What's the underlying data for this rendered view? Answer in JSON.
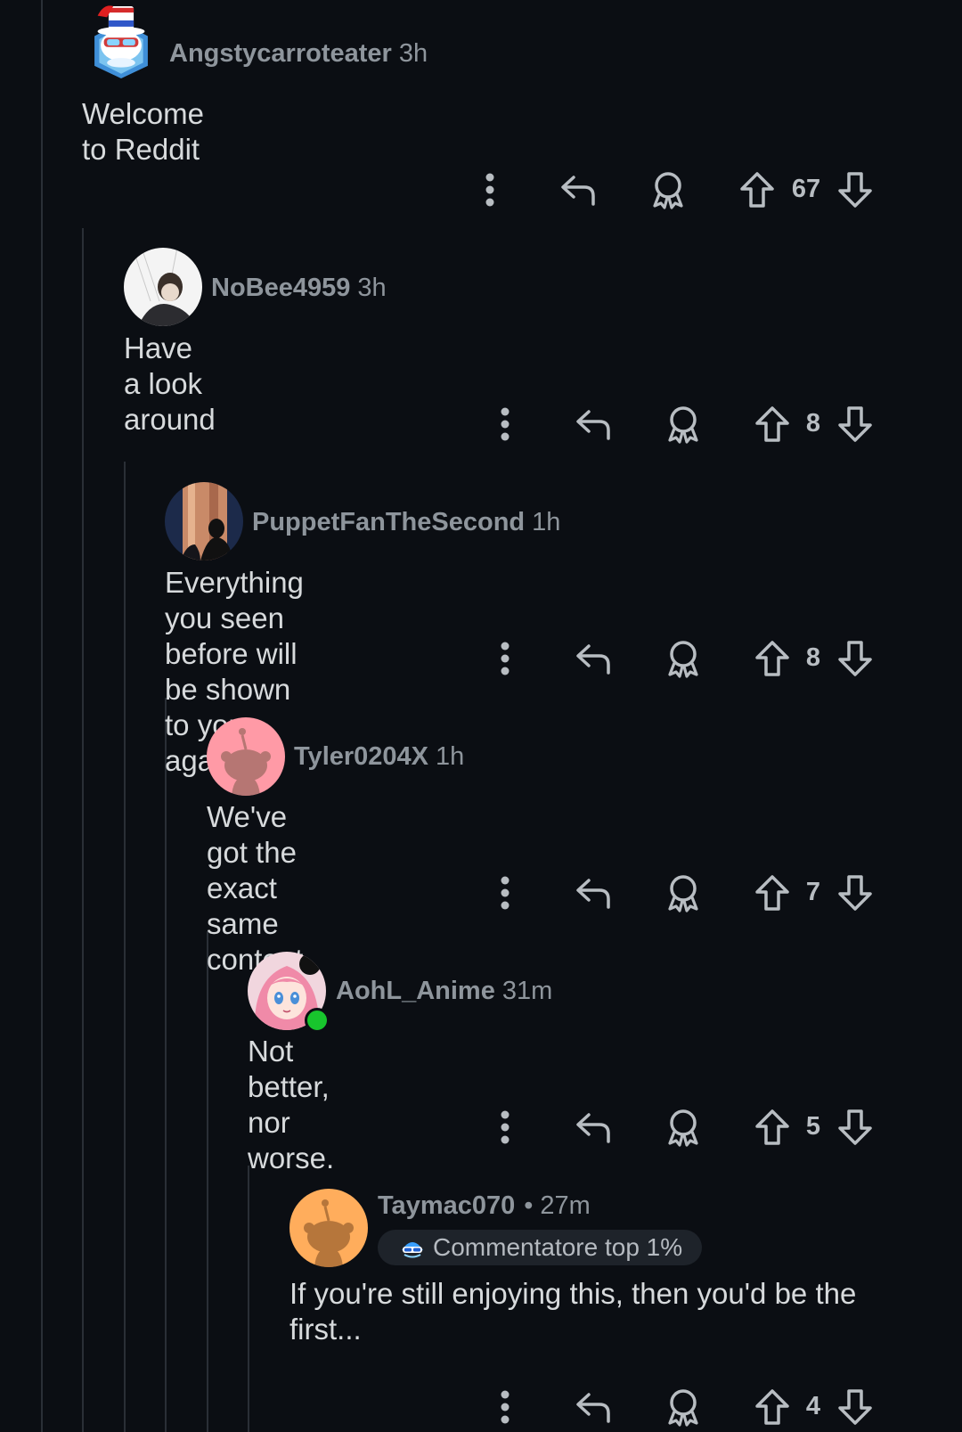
{
  "comments": [
    {
      "author": "Angstycarroteater",
      "time": "3h",
      "body": "Welcome to Reddit",
      "score": "67",
      "avatar": "snoo-avatar-hat-glasses-icon"
    },
    {
      "author": "NoBee4959",
      "time": "3h",
      "body": "Have a look around",
      "score": "8",
      "avatar": "photo-avatar-icon"
    },
    {
      "author": "PuppetFanTheSecond",
      "time": "1h",
      "body": "Everything you seen before will be shown to you again",
      "score": "8",
      "avatar": "photo-avatar-icon"
    },
    {
      "author": "Tyler0204X",
      "time": "1h",
      "body": "We've got the exact same content",
      "score": "7",
      "avatar": "default-snoo-pink-icon"
    },
    {
      "author": "AohL_Anime",
      "time": "31m",
      "body": "Not better, nor worse.",
      "score": "5",
      "avatar": "anime-avatar-icon",
      "online": true
    },
    {
      "author": "Taymac070",
      "separator": "•",
      "time": "27m",
      "badge": "Commentatore top 1%",
      "body": "If you're still enjoying this, then you'd be the first...",
      "score": "4",
      "avatar": "default-snoo-orange-icon"
    }
  ],
  "icons": {
    "more": "more-options-icon",
    "reply": "reply-icon",
    "award": "award-icon",
    "upvote": "upvote-icon",
    "downvote": "downvote-icon"
  },
  "colors": {
    "background": "#0b0e13",
    "text": "#d7dadc",
    "meta": "#8e959c",
    "online": "#18c52d"
  }
}
